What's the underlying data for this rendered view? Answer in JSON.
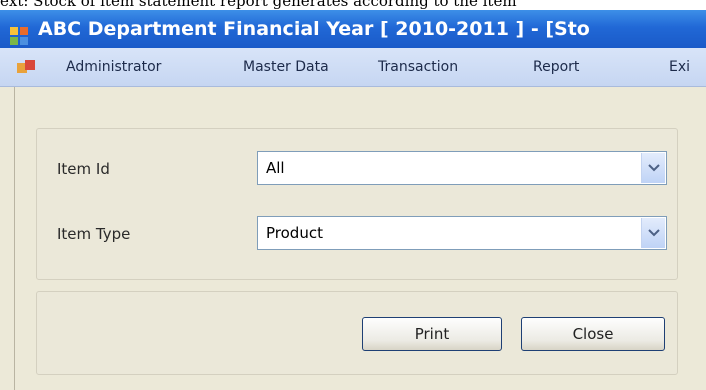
{
  "caption": "ext: Stock of item statement report generates according to the item",
  "window": {
    "title": "ABC Department Financial Year [ 2010-2011 ] - [Sto"
  },
  "menu": {
    "items": [
      {
        "label": "Administrator"
      },
      {
        "label": "Master Data"
      },
      {
        "label": "Transaction"
      },
      {
        "label": "Report"
      },
      {
        "label": "Exi"
      }
    ]
  },
  "form": {
    "item_id": {
      "label": "Item Id",
      "value": "All"
    },
    "item_type": {
      "label": "Item Type",
      "value": "Product"
    }
  },
  "buttons": {
    "print": "Print",
    "close": "Close"
  },
  "colors": {
    "titlebar": "#2168d6",
    "menubar": "#c6d6f2",
    "client": "#ece9d8"
  }
}
